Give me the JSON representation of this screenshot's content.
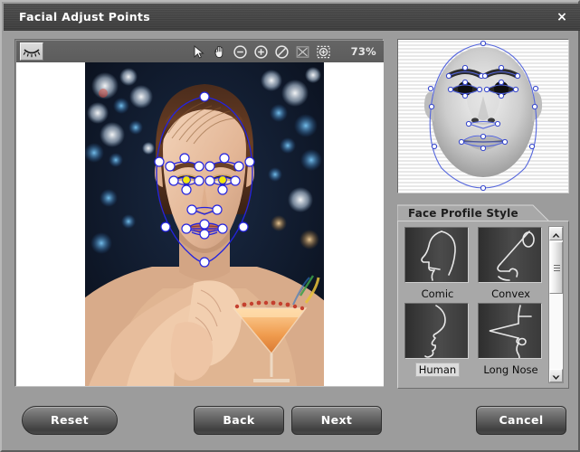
{
  "window": {
    "title": "Facial Adjust Points",
    "close_label": "×",
    "accent_color": "#2222ee",
    "titlebar_color": "#454545",
    "body_color": "#9c9c9c"
  },
  "toolbar": {
    "eye_icon": "closed-eye-icon",
    "tools": [
      {
        "name": "pointer-tool",
        "icon": "cursor-arrow-icon"
      },
      {
        "name": "pan-tool",
        "icon": "hand-icon"
      },
      {
        "name": "zoom-out-tool",
        "icon": "minus-circle-icon"
      },
      {
        "name": "zoom-in-tool",
        "icon": "plus-circle-icon"
      },
      {
        "name": "zoom-reset-tool",
        "icon": "no-zoom-circle-icon"
      },
      {
        "name": "fit-to-window-tool",
        "icon": "fit-window-icon"
      },
      {
        "name": "zoom-to-selection-tool",
        "icon": "marquee-zoom-icon"
      }
    ],
    "zoom_level": "73%"
  },
  "canvas": {
    "name": "facial-adjust-canvas",
    "overlay_line_color": "#2323e0",
    "point_fill_color": "#ffffff",
    "pupil_point_color": "#f2e80c"
  },
  "preview": {
    "name": "face-preview",
    "overlay_line_color": "#5566dd"
  },
  "profile_group": {
    "title": "Face Profile Style",
    "items": [
      {
        "label": "Comic",
        "selected": false
      },
      {
        "label": "Convex",
        "selected": false
      },
      {
        "label": "Human",
        "selected": true
      },
      {
        "label": "Long Nose",
        "selected": false
      }
    ],
    "scrollbar": {
      "up_arrow": "▲",
      "down_arrow": "▼"
    }
  },
  "footer": {
    "reset_label": "Reset",
    "back_label": "Back",
    "next_label": "Next",
    "cancel_label": "Cancel"
  }
}
